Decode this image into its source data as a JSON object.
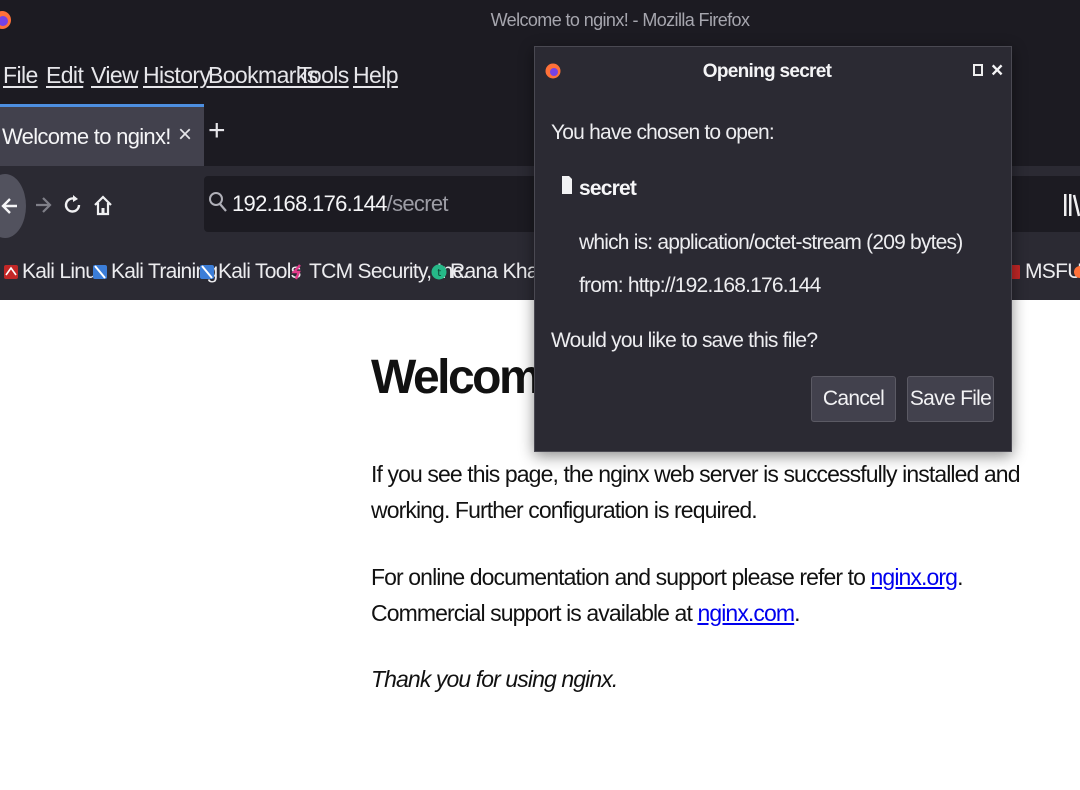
{
  "window": {
    "title": "Welcome to nginx! - Mozilla Firefox"
  },
  "menu": [
    "File",
    "Edit",
    "View",
    "History",
    "Bookmarks",
    "Tools",
    "Help"
  ],
  "tab": {
    "title": "Welcome to nginx!",
    "close_glyph": "×",
    "new_tab_glyph": "+"
  },
  "urlbar": {
    "host": "192.168.176.144",
    "path": "/secret"
  },
  "bookmarks": [
    "Kali Linux",
    "Kali Training",
    "Kali Tools",
    "TCM Security, Inc.",
    "Rana Khalil's",
    "MSFU"
  ],
  "page": {
    "heading": "Welcome to nginx!",
    "p1_line1": "If you see this page, the nginx web server is successfully installed and",
    "p1_line2": "working. Further configuration is required.",
    "p2_line1": "For online documentation and support please refer to ",
    "p2_link1": "nginx.org",
    "p2_line2": "Commercial support is available at ",
    "p2_link2": "nginx.com",
    "period": ".",
    "thanks": "Thank you for using nginx."
  },
  "dialog": {
    "title": "Opening secret",
    "intro": "You have chosen to open:",
    "file_name": "secret",
    "file_type": "which is: application/octet-stream (209 bytes)",
    "file_from": "from: http://192.168.176.144",
    "question": "Would you like to save this file?",
    "cancel_label": "Cancel",
    "save_label": "Save File",
    "close_glyph": "×"
  },
  "colors": {
    "chrome_dark": "#1c1b22",
    "toolbar": "#2b2a33",
    "tab_active": "#42414d",
    "link": "#0000ee"
  }
}
